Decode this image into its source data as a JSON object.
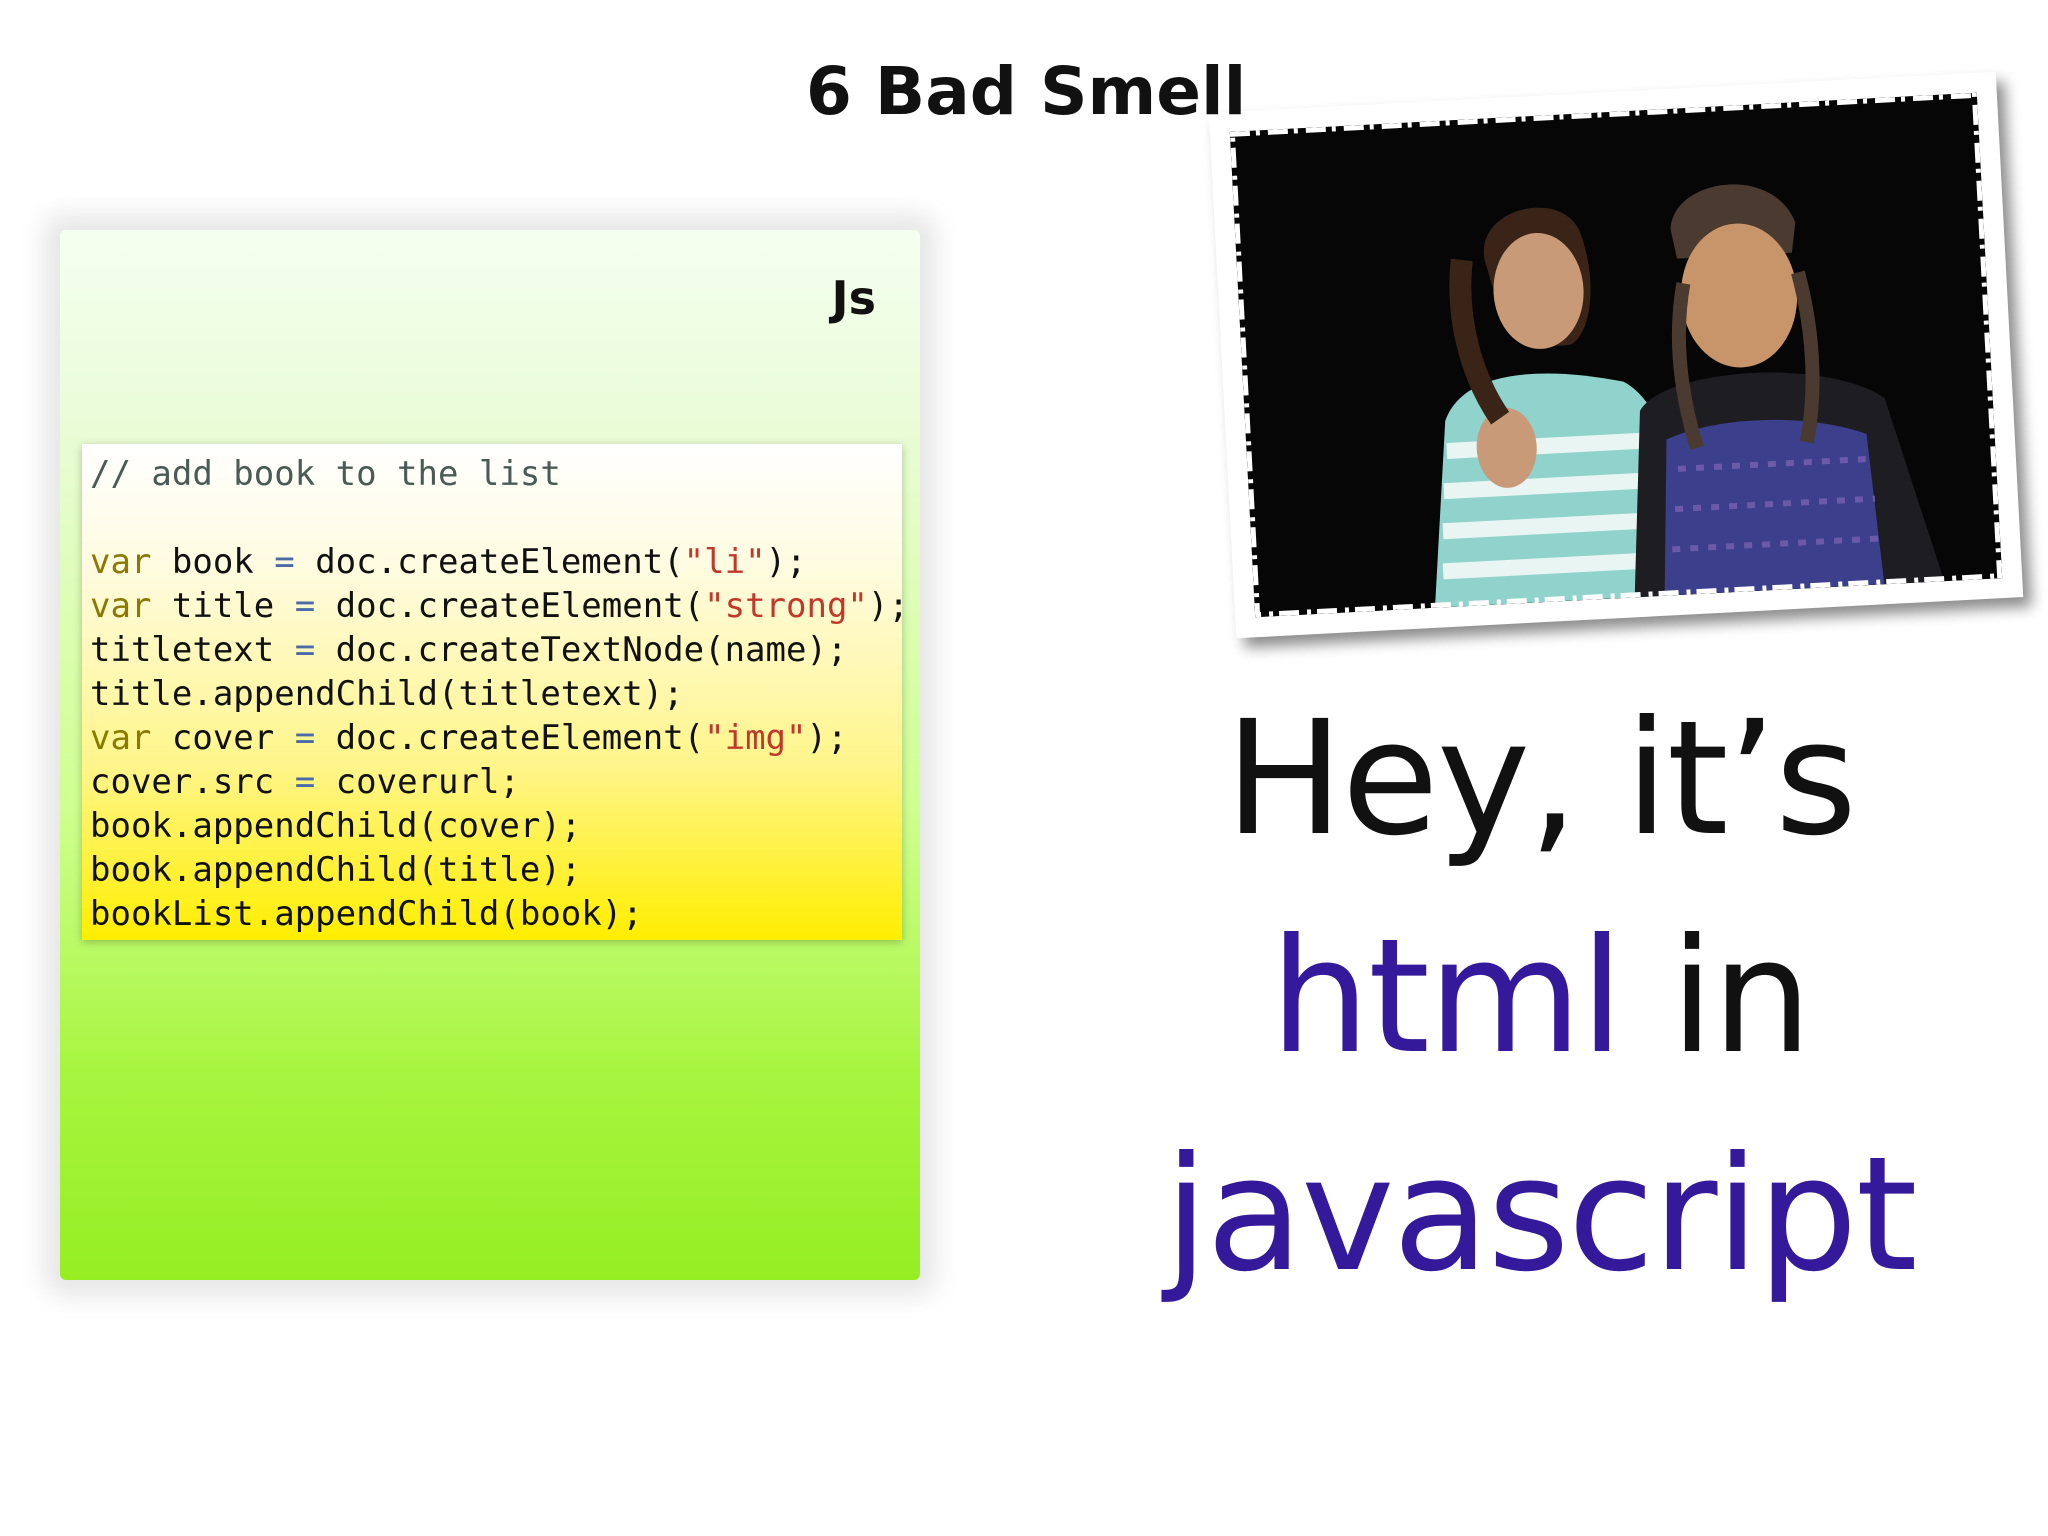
{
  "slide": {
    "title": "6 Bad Smell",
    "panel_label": "Js",
    "code_lines": [
      [
        {
          "t": "// add book to the list",
          "c": "cm"
        }
      ],
      [
        {
          "t": "",
          "c": ""
        }
      ],
      [
        {
          "t": "var",
          "c": "kw"
        },
        {
          "t": " book ",
          "c": ""
        },
        {
          "t": "=",
          "c": "op"
        },
        {
          "t": " doc.createElement(",
          "c": ""
        },
        {
          "t": "\"li\"",
          "c": "str"
        },
        {
          "t": ");",
          "c": ""
        }
      ],
      [
        {
          "t": "var",
          "c": "kw"
        },
        {
          "t": " title ",
          "c": ""
        },
        {
          "t": "=",
          "c": "op"
        },
        {
          "t": " doc.createElement(",
          "c": ""
        },
        {
          "t": "\"strong\"",
          "c": "str"
        },
        {
          "t": ");",
          "c": ""
        }
      ],
      [
        {
          "t": "titletext ",
          "c": ""
        },
        {
          "t": "=",
          "c": "op"
        },
        {
          "t": " doc.createTextNode(name);",
          "c": ""
        }
      ],
      [
        {
          "t": "title.appendChild(titletext);",
          "c": ""
        }
      ],
      [
        {
          "t": "var",
          "c": "kw"
        },
        {
          "t": " cover ",
          "c": ""
        },
        {
          "t": "=",
          "c": "op"
        },
        {
          "t": " doc.createElement(",
          "c": ""
        },
        {
          "t": "\"img\"",
          "c": "str"
        },
        {
          "t": ");",
          "c": ""
        }
      ],
      [
        {
          "t": "cover.src ",
          "c": ""
        },
        {
          "t": "=",
          "c": "op"
        },
        {
          "t": " coverurl;",
          "c": ""
        }
      ],
      [
        {
          "t": "book.appendChild(cover);",
          "c": ""
        }
      ],
      [
        {
          "t": "book.appendChild(title);",
          "c": ""
        }
      ],
      [
        {
          "t": "bookList.appendChild(book);",
          "c": ""
        }
      ]
    ],
    "statement": {
      "line1": "Hey, it’s",
      "line2_accent": "html",
      "line2_rest": " in",
      "line3_accent": "javascript"
    },
    "colors": {
      "accent": "#34199a",
      "keyword": "#8a7a00",
      "string": "#c0392b"
    },
    "photo": {
      "icon": "photo-two-women-grimacing"
    }
  }
}
